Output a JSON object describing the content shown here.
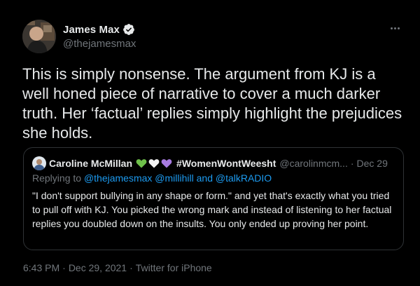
{
  "author": {
    "name": "James Max",
    "handle": "@thejamesmax",
    "verified_icon": "verified-badge",
    "more_icon": "more-options-icon"
  },
  "tweet": {
    "text": "This is simply nonsense. The argument from KJ is a well honed piece of narrative to cover a much darker truth. Her ‘factual’ replies simply highlight the prejudices she holds."
  },
  "quote": {
    "name": "Caroline McMillan",
    "hearts": [
      "green-heart",
      "white-heart",
      "purple-heart"
    ],
    "hashtag": "#WomenWontWeesht",
    "handle": "@carolinmcm...",
    "separator": "·",
    "date": "Dec 29",
    "replying_prefix": "Replying to ",
    "replying_mentions": "@thejamesmax @millihill and @talkRADIO",
    "text": "\"I don't support bullying in any shape or form.\" and yet that's exactly what you tried to pull off with KJ. You picked the wrong mark and instead of listening to her factual replies you doubled down on the insults. You only ended up proving her point."
  },
  "meta": {
    "time": "6:43 PM",
    "separator": "·",
    "date": "Dec 29, 2021",
    "source": "Twitter for iPhone"
  },
  "colors": {
    "background": "#000000",
    "text": "#e7e9ea",
    "secondary": "#71767b",
    "accent": "#1d9bf0",
    "border": "#2f3336"
  }
}
